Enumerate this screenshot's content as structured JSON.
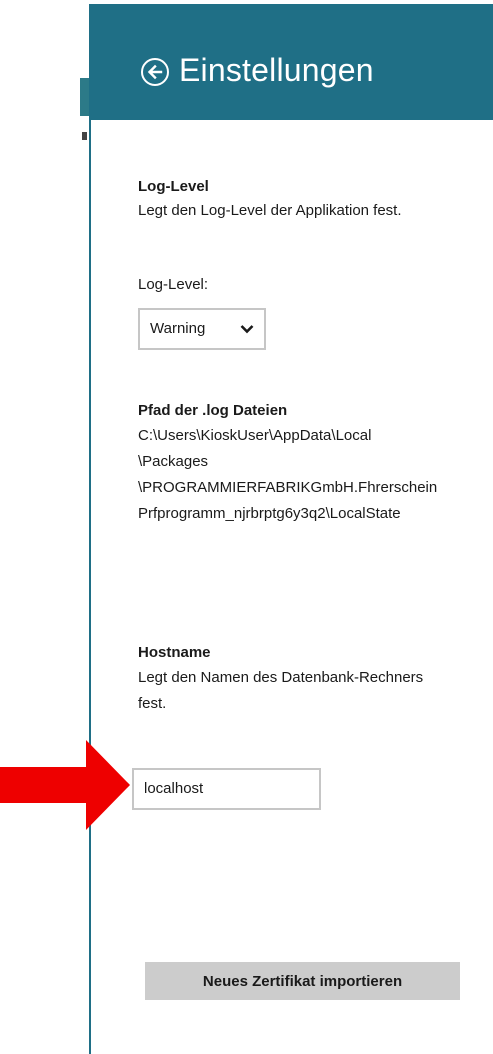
{
  "window": {
    "title": "Einstellungen",
    "accent_color": "#1f6f86"
  },
  "header": {
    "back_icon": "back-arrow-circle-icon"
  },
  "log_level_section": {
    "title": "Log-Level",
    "description": "Legt den Log-Level der Applikation fest.",
    "select_label": "Log-Level:",
    "selected_value": "Warning",
    "chevron_icon": "chevron-down-icon"
  },
  "log_path_section": {
    "title": "Pfad der .log Dateien",
    "path_lines": [
      "C:\\Users\\KioskUser\\AppData\\Local",
      "\\Packages",
      "\\PROGRAMMIERFABRIKGmbH.Fhrerschein",
      "Prfprogramm_njrbrptg6y3q2\\LocalState"
    ]
  },
  "hostname_section": {
    "title": "Hostname",
    "description_lines": [
      "Legt den Namen des Datenbank-Rechners",
      "fest."
    ],
    "input_value": "localhost"
  },
  "import_button": {
    "label": "Neues Zertifikat importieren"
  },
  "annotation": {
    "arrow_color": "#ee0000"
  }
}
